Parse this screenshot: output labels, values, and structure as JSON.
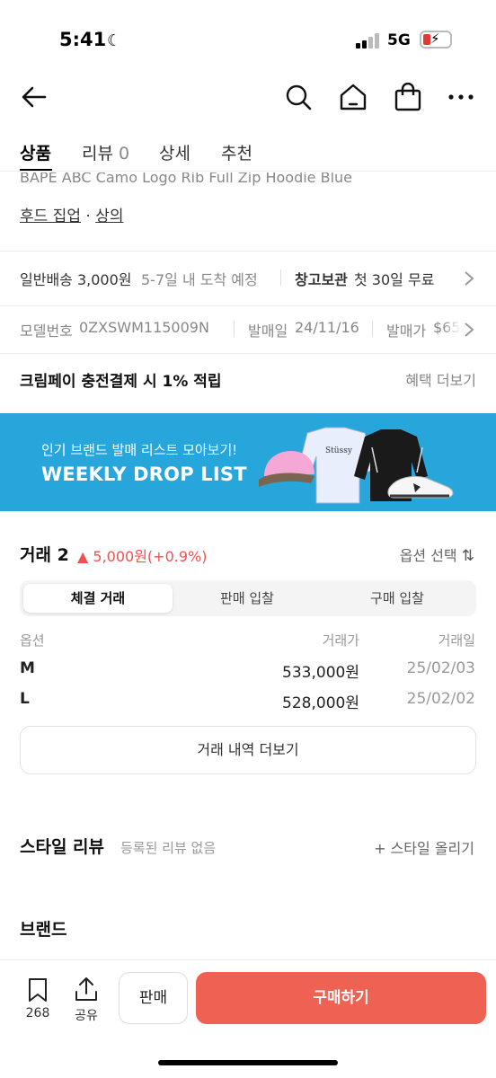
{
  "status": {
    "time": "5:41",
    "network": "5G"
  },
  "tabs": [
    {
      "label": "상품"
    },
    {
      "label": "리뷰",
      "count": "0"
    },
    {
      "label": "상세"
    },
    {
      "label": "추천"
    }
  ],
  "product": {
    "title_cut": "BAPE ABC Camo Logo Rib Full Zip Hoodie Blue",
    "category1": "후드 집업",
    "category_sep": "·",
    "category2": "상의"
  },
  "shipping": {
    "label": "일반배송 3,000원",
    "eta": "5-7일 내 도착 예정",
    "storage_label": "창고보관",
    "storage_value": "첫 30일 무료"
  },
  "info": {
    "model_label": "모델번호",
    "model_value": "0ZXSWM115009N",
    "release_label": "발매일",
    "release_value": "24/11/16",
    "price_label": "발매가",
    "price_value": "$65"
  },
  "promo": {
    "text": "크림페이 충전결제 시 1% 적립",
    "link": "혜택 더보기"
  },
  "banner": {
    "subtitle": "인기 브랜드 발매 리스트 모아보기!",
    "title": "WEEKLY DROP LIST",
    "color": "#27a6dc"
  },
  "trade": {
    "title": "거래 2",
    "change_arrow": "▲",
    "change": "5,000원(+0.9%)",
    "option_select": "옵션 선택",
    "segments": [
      "체결 거래",
      "판매 입찰",
      "구매 입찰"
    ],
    "headers": {
      "option": "옵션",
      "price": "거래가",
      "date": "거래일"
    },
    "rows": [
      {
        "option": "M",
        "price": "533,000원",
        "date": "25/02/03"
      },
      {
        "option": "L",
        "price": "528,000원",
        "date": "25/02/02"
      }
    ],
    "more": "거래 내역 더보기"
  },
  "style": {
    "title": "스타일 리뷰",
    "empty": "등록된 리뷰 없음",
    "upload": "+ 스타일 올리기"
  },
  "brand": {
    "title": "브랜드"
  },
  "bottom": {
    "bookmark_count": "268",
    "share_label": "공유",
    "sell": "판매",
    "buy": "구매하기",
    "buy_color": "#ef6253"
  }
}
